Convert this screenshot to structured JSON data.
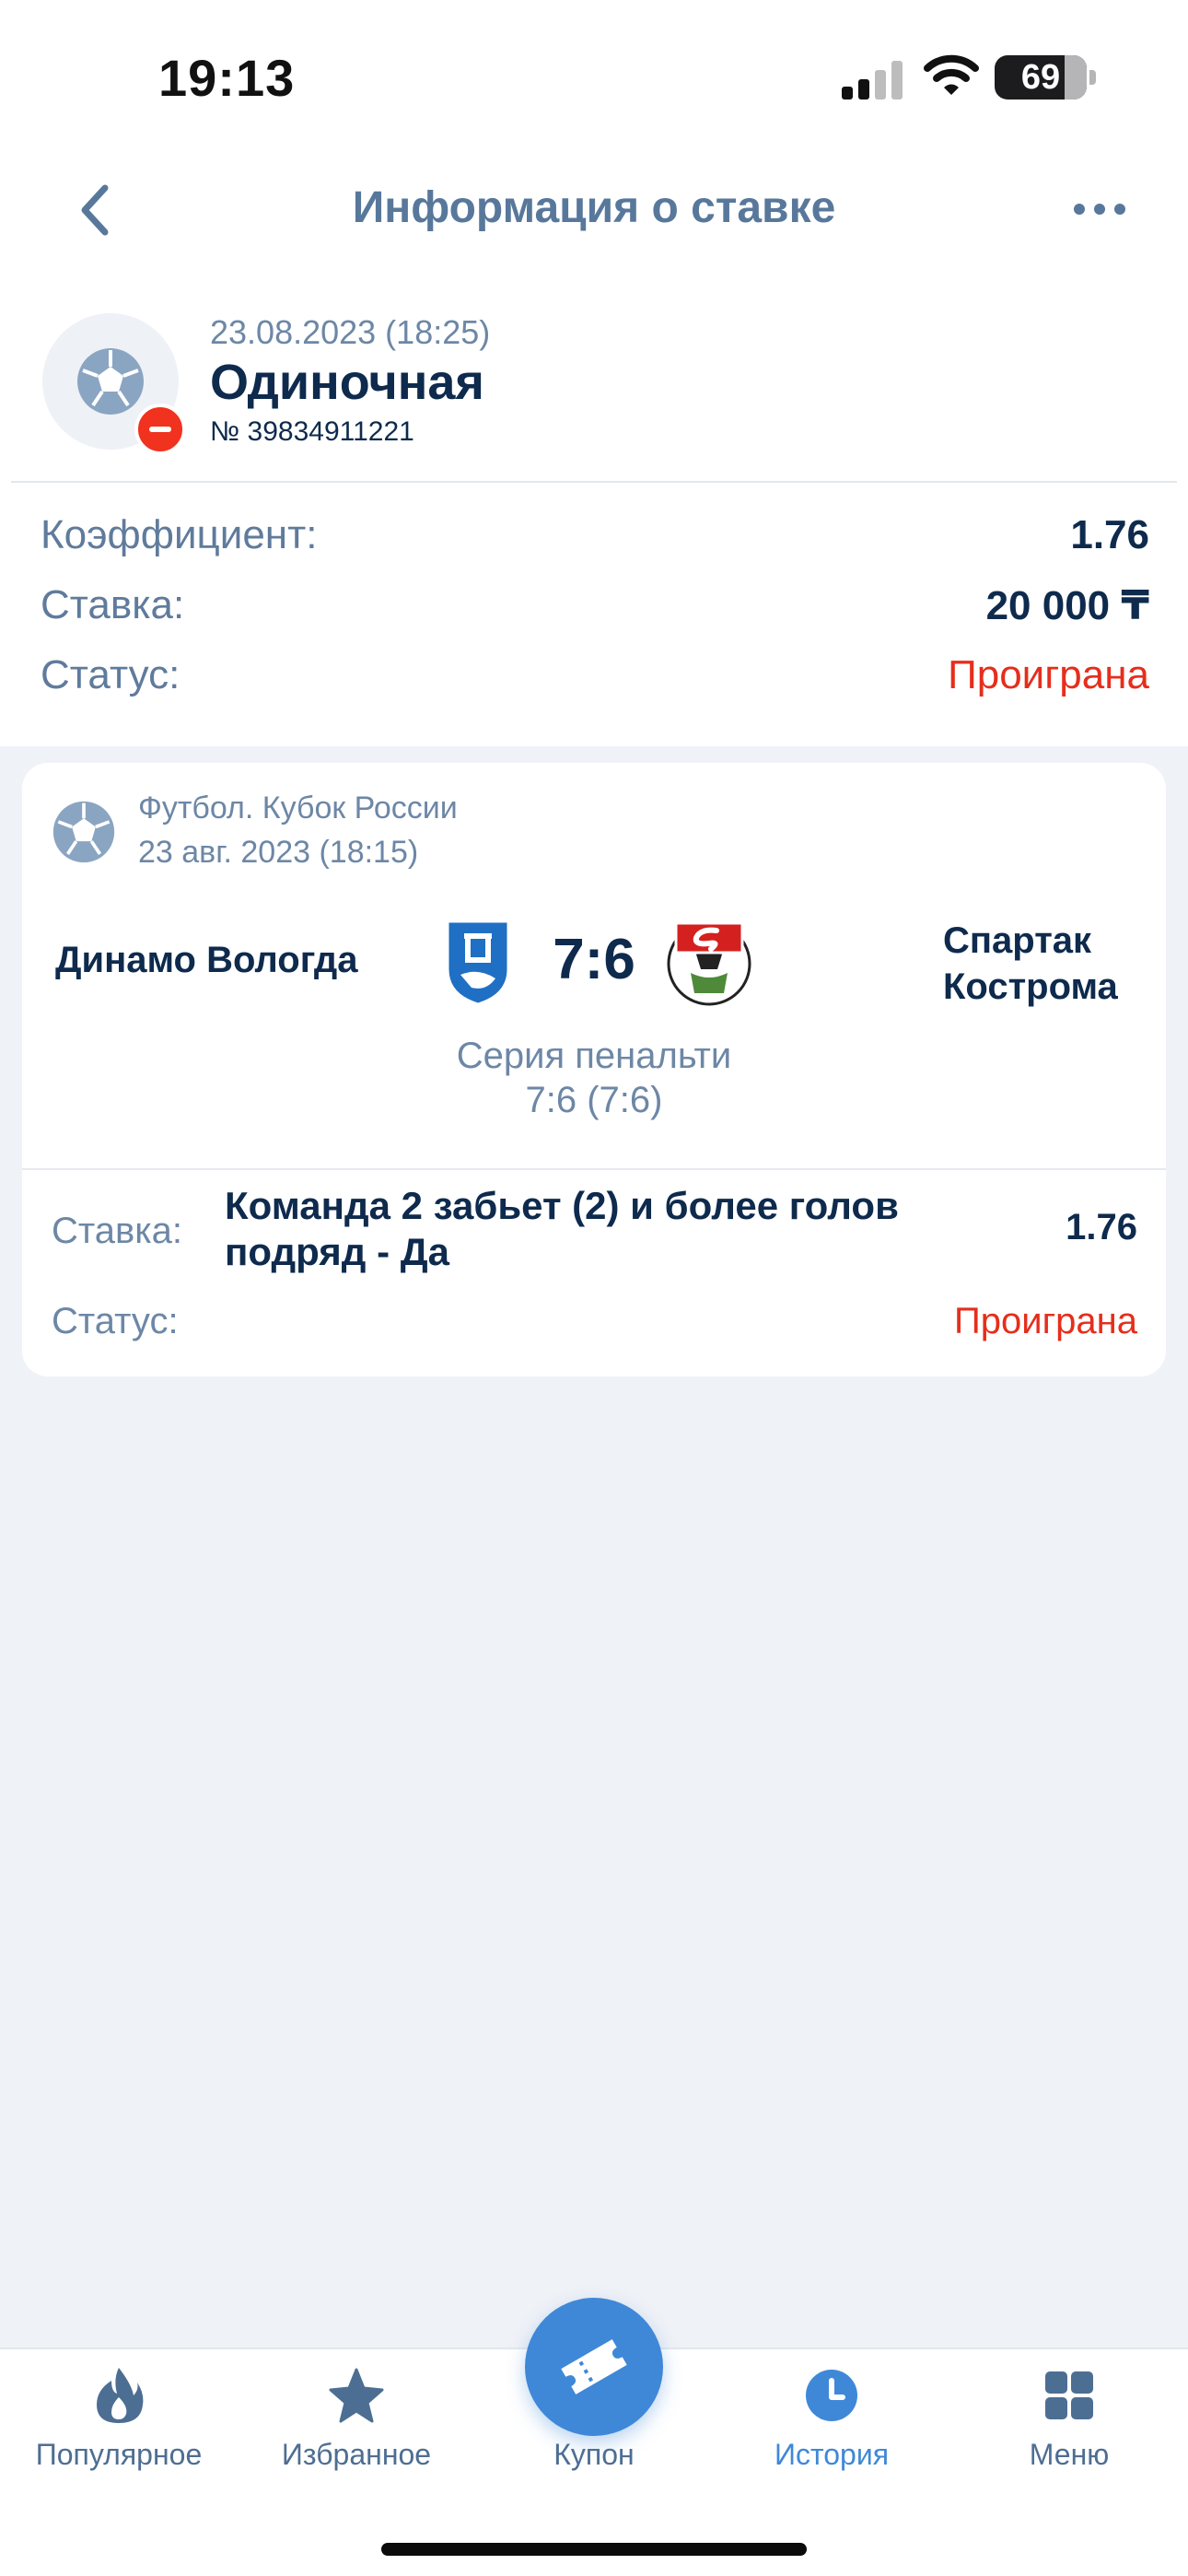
{
  "status_bar": {
    "time": "19:13",
    "battery": "69"
  },
  "nav": {
    "title": "Информация о ставке"
  },
  "bet": {
    "date": "23.08.2023 (18:25)",
    "type": "Одиночная",
    "number": "№ 39834911221",
    "rows": [
      {
        "label": "Коэффициент:",
        "value": "1.76"
      },
      {
        "label": "Ставка:",
        "value": "20 000 ₸"
      },
      {
        "label": "Статус:",
        "value": "Проиграна"
      }
    ]
  },
  "event": {
    "league": "Футбол. Кубок России",
    "date": "23 авг. 2023 (18:15)",
    "team1": "Динамо Вологда",
    "team2": "Спартак Кострома",
    "score": "7:6",
    "penalty_title": "Серия пенальти",
    "penalty_score": "7:6 (7:6)",
    "pick_label": "Ставка:",
    "pick_text": "Команда 2 забьет (2) и более голов подряд - Да",
    "pick_coef": "1.76",
    "status_label": "Статус:",
    "status_value": "Проиграна"
  },
  "tabs": [
    {
      "label": "Популярное",
      "icon": "flame-icon"
    },
    {
      "label": "Избранное",
      "icon": "star-icon"
    },
    {
      "label": "Купон",
      "icon": "ticket-icon"
    },
    {
      "label": "История",
      "icon": "clock-icon"
    },
    {
      "label": "Меню",
      "icon": "grid-icon"
    }
  ],
  "colors": {
    "accent": "#3f88d8",
    "lost": "#e52e1c",
    "title": "#58789b",
    "text": "#0e2a4d",
    "muted": "#6d87a6"
  }
}
